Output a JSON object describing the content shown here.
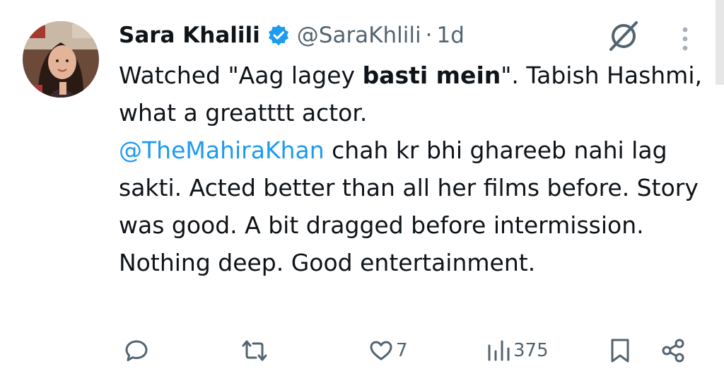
{
  "tweet": {
    "author_name": "Sara Khalili",
    "handle": "@SaraKhlili",
    "separator": "·",
    "time": "1d",
    "text_part1": "Watched \"Aag lagey ",
    "text_bold": "basti mein",
    "text_part2": "\". Tabish Hashmi, what a greatttt actor.",
    "mention": "@TheMahiraKhan",
    "text_part3": " chah kr bhi ghareeb nahi lag sakti. Acted better than all her films before. Story was good. A bit dragged before intermission. Nothing deep. Good entertainment."
  },
  "actions": {
    "reply_icon": "reply-icon",
    "retweet_icon": "retweet-icon",
    "like_icon": "heart-icon",
    "like_count": "7",
    "views_icon": "views-icon",
    "views_count": "375",
    "bookmark_icon": "bookmark-icon",
    "share_icon": "share-icon"
  },
  "colors": {
    "text": "#0f1419",
    "secondary": "#536471",
    "accent": "#1d9bf0"
  }
}
